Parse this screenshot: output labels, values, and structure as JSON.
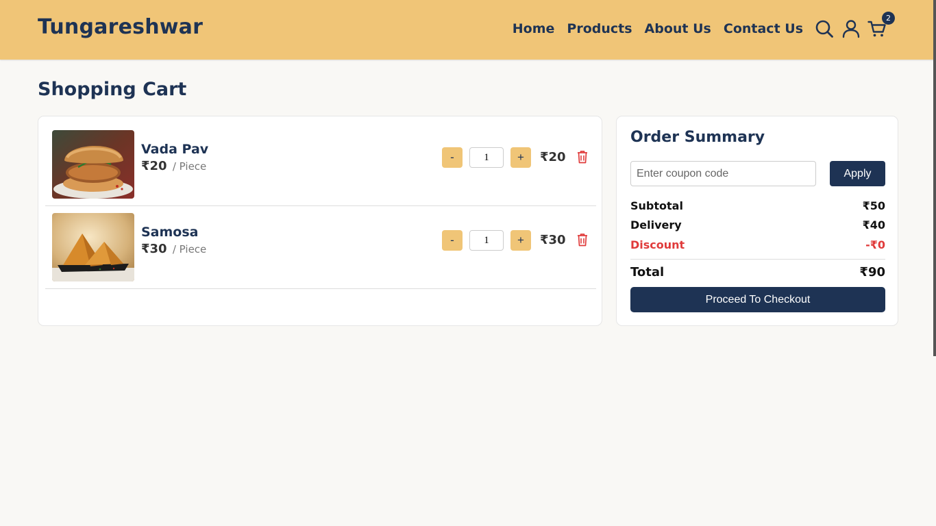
{
  "brand": {
    "name": "Tungareshwar",
    "accent": "#f0c577",
    "primary": "#1e3354",
    "danger": "#e03b3b"
  },
  "nav": {
    "items": [
      {
        "label": "Home"
      },
      {
        "label": "Products"
      },
      {
        "label": "About Us"
      },
      {
        "label": "Contact Us"
      }
    ],
    "icons": [
      "search-icon",
      "user-icon",
      "cart-icon"
    ],
    "cart_count": "2"
  },
  "page": {
    "title": "Shopping Cart"
  },
  "cart": {
    "items": [
      {
        "name": "Vada Pav",
        "price": "₹20",
        "unit": "/ Piece",
        "quantity": "1",
        "line_total": "₹20",
        "minus": "-",
        "plus": "+"
      },
      {
        "name": "Samosa",
        "price": "₹30",
        "unit": "/ Piece",
        "quantity": "1",
        "line_total": "₹30",
        "minus": "-",
        "plus": "+"
      }
    ]
  },
  "summary": {
    "title": "Order Summary",
    "coupon_placeholder": "Enter coupon code",
    "apply_label": "Apply",
    "subtotal_label": "Subtotal",
    "subtotal_value": "₹50",
    "delivery_label": "Delivery",
    "delivery_value": "₹40",
    "discount_label": "Discount",
    "discount_value": "-₹0",
    "total_label": "Total",
    "total_value": "₹90",
    "checkout_label": "Proceed To Checkout"
  }
}
